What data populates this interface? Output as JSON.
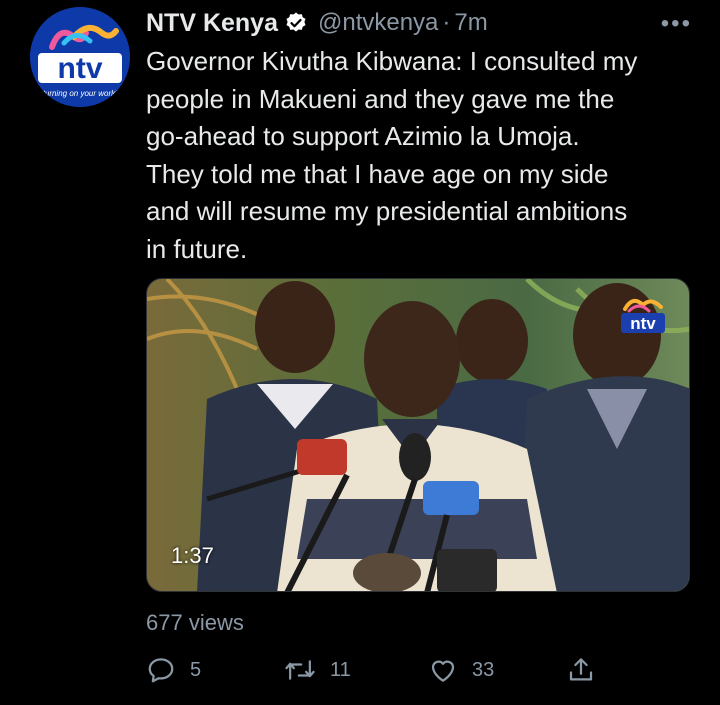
{
  "tweet": {
    "author_name": "NTV Kenya",
    "handle": "@ntvkenya",
    "separator": "·",
    "time": "7m",
    "more_label": "•••",
    "text": "Governor Kivutha Kibwana: I consulted my\npeople in Makueni and they gave me the\ngo-ahead to support Azimio la Umoja.\nThey told me that I have age on my side\nand will resume my presidential ambitions\nin future.",
    "avatar": {
      "logo_text": "ntv",
      "tagline": "turning on your world"
    },
    "media": {
      "type": "video",
      "duration": "1:37",
      "watermark": "ntv"
    },
    "views": "677 views",
    "actions": {
      "reply_count": "5",
      "retweet_count": "11",
      "like_count": "33"
    }
  },
  "colors": {
    "background": "#000000",
    "text_primary": "#e7e9ea",
    "text_secondary": "#8b98a5",
    "verified": "#ffffff",
    "ntv_blue": "#0d3aa8"
  },
  "icons": [
    "verified-icon",
    "more-icon",
    "reply-icon",
    "retweet-icon",
    "like-icon",
    "share-icon"
  ]
}
